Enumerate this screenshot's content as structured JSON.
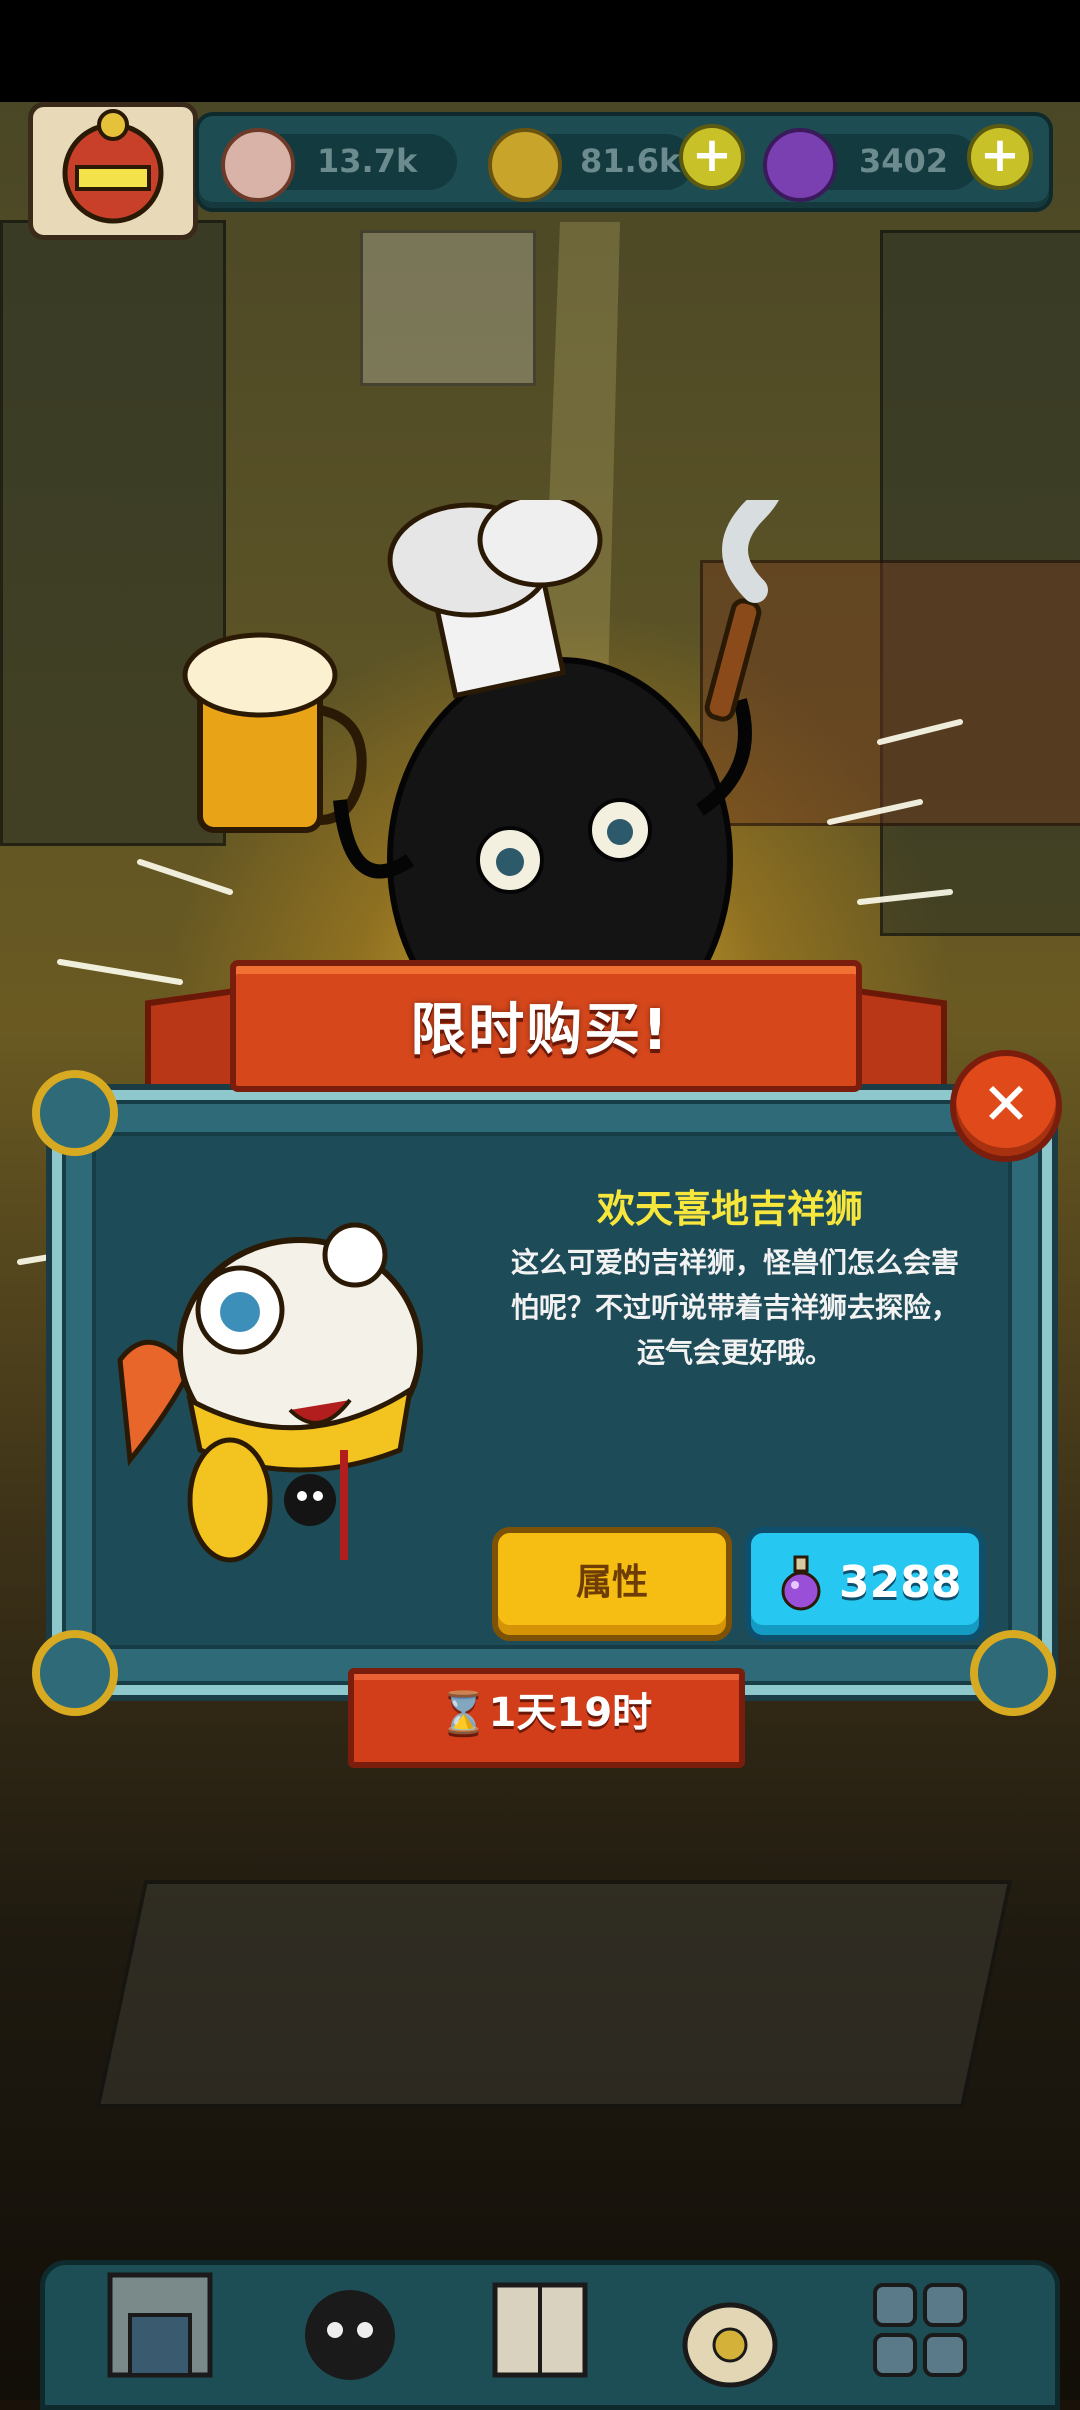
{
  "hud": {
    "eyeballs": "13.7k",
    "coins": "81.6k",
    "potions": "3402",
    "plus_label": "+"
  },
  "offer": {
    "banner_title": "限时购买!",
    "item_name": "欢天喜地吉祥狮",
    "description_lines": [
      "这么可爱的吉祥狮，怪兽们怎么会害",
      "怕呢？不过听说带着吉祥狮去探险，",
      "运气会更好哦。"
    ],
    "attributes_button": "属性",
    "price": "3288",
    "timer": "1天19时",
    "close_label": "✕"
  },
  "colors": {
    "banner": "#d6471c",
    "item_name": "#f7e63c",
    "attr_button": "#f6bd12",
    "buy_button": "#26c7f0",
    "dialog": "#1d4c58"
  },
  "icons": {
    "close": "close-icon",
    "potion": "potion-icon",
    "hourglass": "hourglass-icon",
    "eyeball": "eyeball-icon",
    "coin": "coin-icon"
  }
}
